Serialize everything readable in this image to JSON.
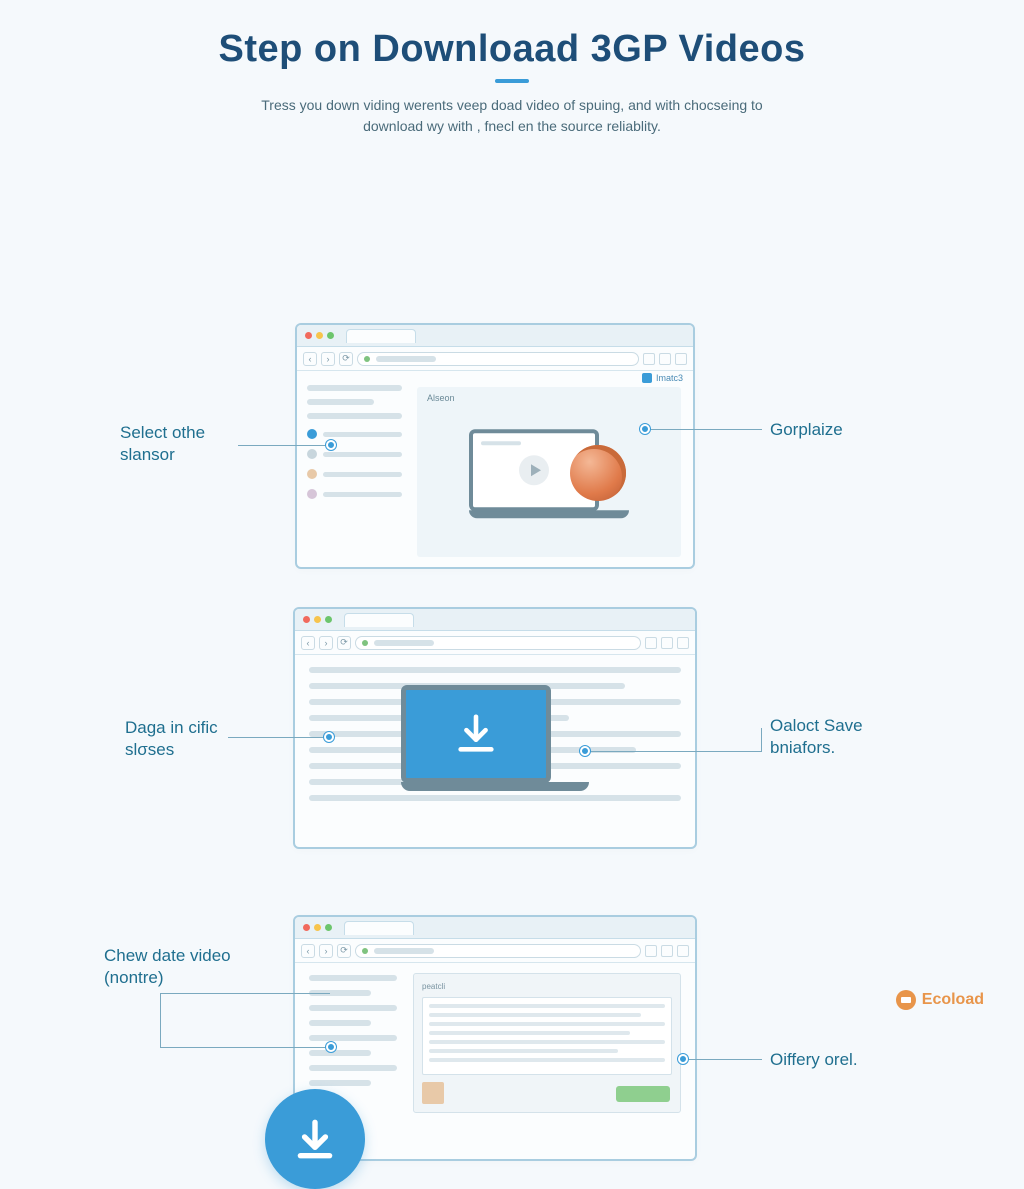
{
  "header": {
    "title": "Step on Downloaad 3GP Videos",
    "subtitle": "Tress you down viding werents veep doad video of spuing, and with chocseing to download wy with , fnecl en the source reliablity."
  },
  "browser1": {
    "user_label": "Imatc3",
    "main_label": "Alseon"
  },
  "browser3": {
    "panel_label": "peatcli"
  },
  "callouts": {
    "left1": "Select othe slansor",
    "right1": "Gorplaize",
    "left2": "Daga in cific slσses",
    "right2": "Oaloct Save bniafors.",
    "left3": "Chew date video (nontre)",
    "right3": "Oiffery orel."
  },
  "footer": {
    "brand": "Ecoload"
  }
}
